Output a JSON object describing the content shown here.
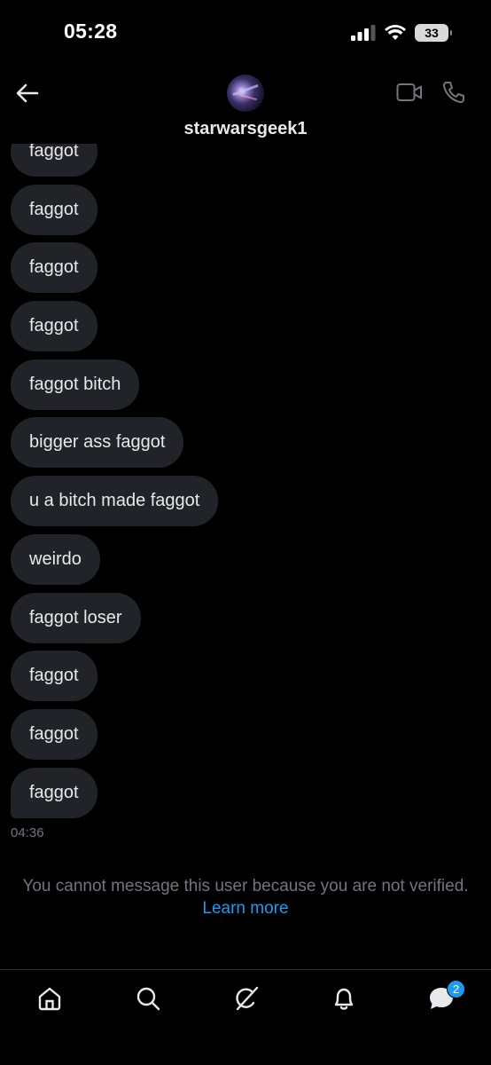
{
  "status_bar": {
    "time": "05:28",
    "battery": "33",
    "icons": [
      "cellular-signal-icon",
      "wifi-icon",
      "battery-icon"
    ]
  },
  "header": {
    "username": "starwarsgeek1",
    "back_icon": "arrow-left-icon",
    "video_icon": "video-camera-icon",
    "call_icon": "phone-icon"
  },
  "messages": [
    "faggot",
    "faggot",
    "faggot",
    "faggot",
    "faggot bitch",
    "bigger ass faggot",
    "u a bitch made faggot",
    "weirdo",
    "faggot loser",
    "faggot",
    "faggot",
    "faggot"
  ],
  "last_message_time": "04:36",
  "notice": {
    "text": "You cannot message this user because you are not verified.",
    "link": "Learn more"
  },
  "tab_bar": {
    "tabs": [
      "home-icon",
      "search-icon",
      "grok-icon",
      "bell-icon",
      "messages-icon"
    ],
    "messages_badge": "2"
  },
  "colors": {
    "background": "#000000",
    "bubble": "#202327",
    "text": "#e7e9ea",
    "muted": "#71767b",
    "accent": "#1d9bf0"
  }
}
